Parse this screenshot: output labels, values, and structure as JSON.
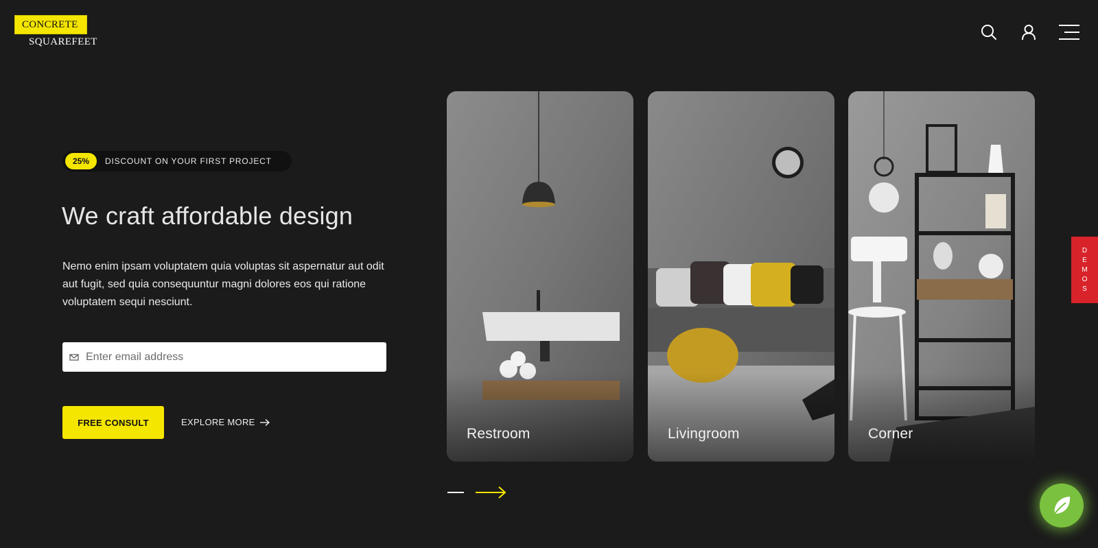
{
  "brand": {
    "logo_top": "CONCRETE",
    "logo_bottom": "SQUAREFEET",
    "accent": "#f5e600"
  },
  "header": {
    "icons": [
      "search-icon",
      "user-icon",
      "hamburger-menu-icon"
    ]
  },
  "hero": {
    "badge_percent": "25%",
    "badge_text": "DISCOUNT ON YOUR FIRST PROJECT",
    "title": "We craft affordable design",
    "description": "Nemo enim ipsam voluptatem quia voluptas sit aspernatur aut odit aut fugit, sed quia consequuntur magni dolores eos qui ratione voluptatem sequi nesciunt.",
    "email_placeholder": "Enter email address",
    "consult_label": "FREE CONSULT",
    "explore_label": "EXPLORE MORE"
  },
  "cards": [
    {
      "label": "Restroom"
    },
    {
      "label": "Livingroom"
    },
    {
      "label": "Corner"
    }
  ],
  "side_tab": {
    "letters": [
      "D",
      "E",
      "M",
      "O",
      "S"
    ],
    "color": "#d8232a"
  },
  "chat_widget": {
    "color": "#7ac13f",
    "icon": "chat-bubble-icon"
  }
}
